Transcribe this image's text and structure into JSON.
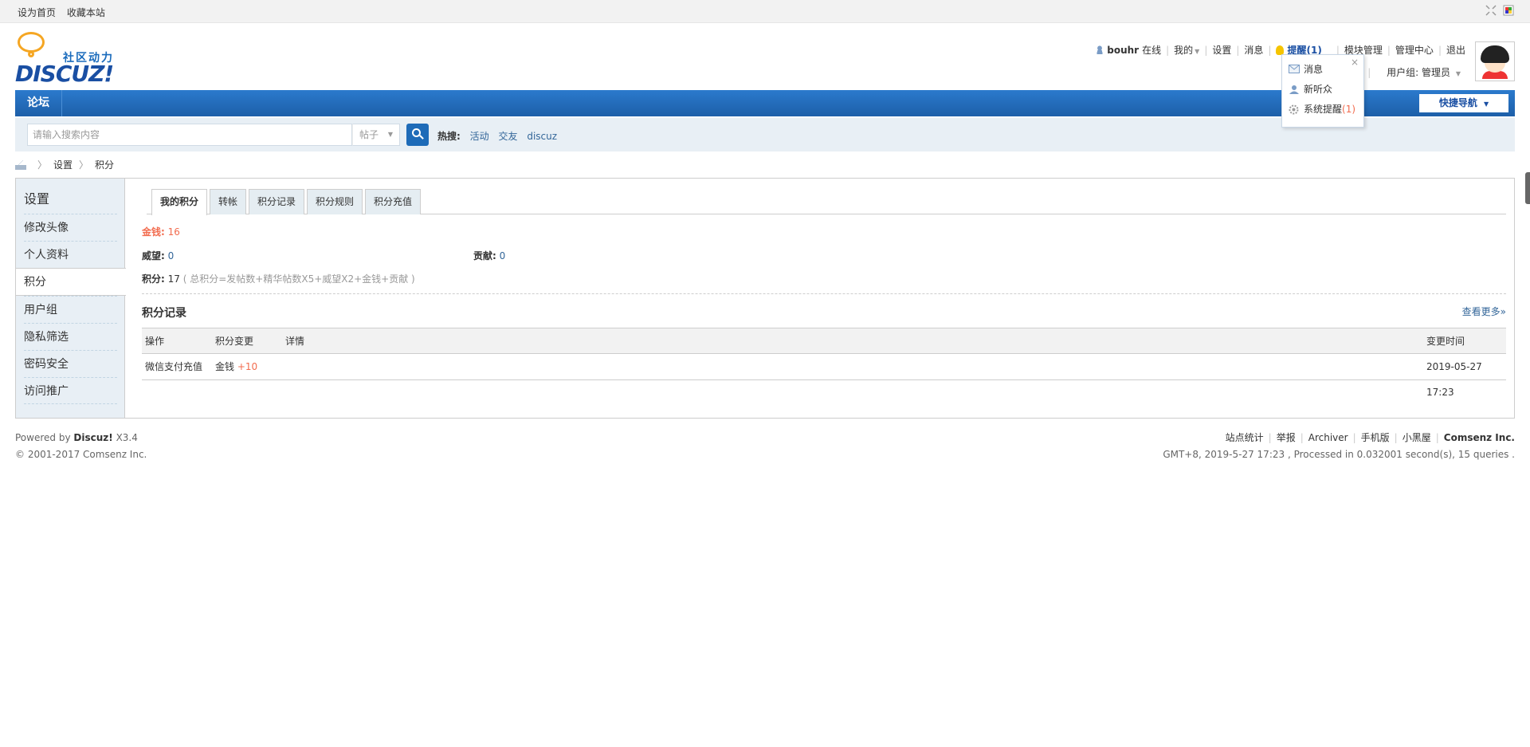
{
  "topbar": {
    "set_home": "设为首页",
    "bookmark": "收藏本站"
  },
  "logo": {
    "slogan": "社区动力",
    "word": "DISCUZ!"
  },
  "userbar": {
    "username": "bouhr",
    "online": "在线",
    "mine": "我的",
    "settings": "设置",
    "messages": "消息",
    "remind": "提醒(1)",
    "module_admin": "模块管理",
    "admin_center": "管理中心",
    "logout": "退出",
    "usergroup": "用户组: 管理员"
  },
  "popup": {
    "close": "×",
    "items": [
      {
        "label": "消息",
        "count": ""
      },
      {
        "label": "新听众",
        "count": ""
      },
      {
        "label": "系统提醒",
        "count": "(1)"
      }
    ]
  },
  "nav": {
    "home": "论坛",
    "quick_nav": "快捷导航"
  },
  "search": {
    "placeholder": "请输入搜索内容",
    "type": "帖子",
    "hot_label": "热搜:",
    "hot": [
      "活动",
      "交友",
      "discuz"
    ]
  },
  "breadcrumb": [
    "设置",
    "积分"
  ],
  "sidebar": {
    "title": "设置",
    "items": [
      "修改头像",
      "个人资料",
      "积分",
      "用户组",
      "隐私筛选",
      "密码安全",
      "访问推广"
    ]
  },
  "tabs": [
    "我的积分",
    "转帐",
    "积分记录",
    "积分规则",
    "积分充值"
  ],
  "credits": {
    "money_label": "金钱:",
    "money": "16",
    "prestige_label": "威望:",
    "prestige": "0",
    "contribution_label": "贡献:",
    "contribution": "0",
    "total_label": "积分:",
    "total": "17",
    "total_note": "( 总积分=发帖数+精华帖数X5+威望X2+金钱+贡献 )"
  },
  "records": {
    "title": "积分记录",
    "more": "查看更多»",
    "headers": {
      "action": "操作",
      "change": "积分变更",
      "detail": "详情",
      "time": "变更时间"
    },
    "rows": [
      {
        "action": "微信支付充值",
        "change_type": "金钱",
        "change_value": "+10",
        "detail": "",
        "time": "2019-05-27 17:23"
      }
    ]
  },
  "footer": {
    "powered": "Powered by",
    "product": "Discuz!",
    "version": "X3.4",
    "copyright": "© 2001-2017 Comsenz Inc.",
    "links": [
      "站点统计",
      "举报",
      "Archiver",
      "手机版",
      "小黑屋"
    ],
    "company": "Comsenz Inc.",
    "stats": "GMT+8, 2019-5-27 17:23 , Processed in 0.032001 second(s), 15 queries ."
  }
}
